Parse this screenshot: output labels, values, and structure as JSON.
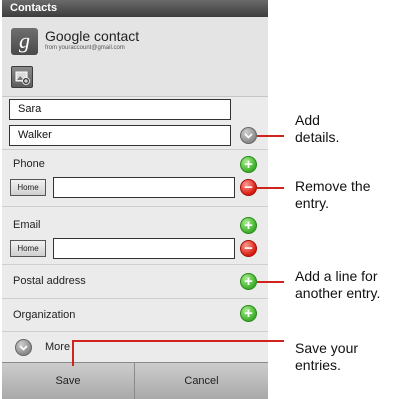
{
  "window": {
    "title": "Contacts"
  },
  "account": {
    "icon_letter": "g",
    "name": "Google contact",
    "email": "from youraccount@gmail.com"
  },
  "name_fields": {
    "first": "Sara",
    "last": "Walker"
  },
  "sections": {
    "phone": {
      "label": "Phone",
      "type_button": "Home",
      "value": ""
    },
    "email": {
      "label": "Email",
      "type_button": "Home",
      "value": ""
    },
    "postal": {
      "label": "Postal address"
    },
    "organization": {
      "label": "Organization"
    },
    "more": {
      "label": "More"
    }
  },
  "buttons": {
    "save": "Save",
    "cancel": "Cancel"
  },
  "callouts": {
    "add_details": [
      "Add",
      "details."
    ],
    "remove_entry": [
      "Remove the",
      "entry."
    ],
    "add_line": [
      "Add a line for",
      "another entry."
    ],
    "save_entries": [
      "Save your",
      "entries."
    ]
  },
  "colors": {
    "callout_line": "#d0231c",
    "add_green": "#3cb028",
    "remove_red": "#d91a10"
  },
  "icons": {
    "account": "google-account-icon",
    "photo": "contact-photo-icon",
    "add": "add-icon",
    "remove": "remove-icon",
    "expand": "chevron-down-icon"
  }
}
